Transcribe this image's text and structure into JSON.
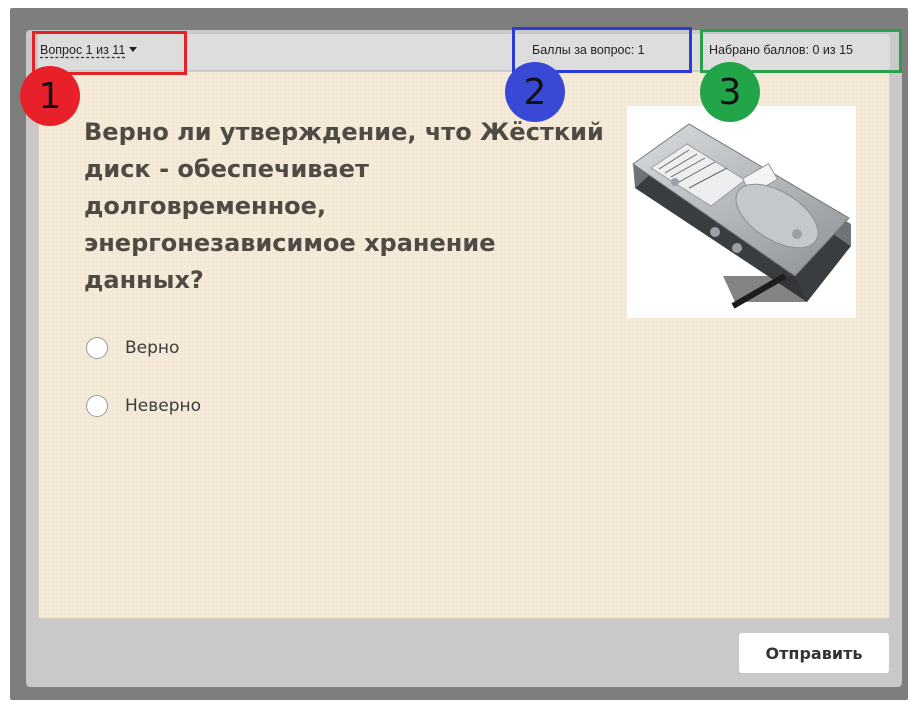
{
  "header": {
    "question_nav_label": "Вопрос 1 из 11",
    "points_per_question": "Баллы за вопрос: 1",
    "points_total": "Набрано баллов: 0 из 15"
  },
  "question": {
    "text": "Верно ли утверждение, что Жёсткий диск - обеспечивает долговременное, энергонезависимое хранение данных?",
    "image_icon": "hard-drive-image"
  },
  "options": [
    {
      "label": "Верно",
      "selected": false
    },
    {
      "label": "Неверно",
      "selected": false
    }
  ],
  "footer": {
    "submit_label": "Отправить"
  },
  "annotations": [
    {
      "number": "1",
      "color": "#e62225"
    },
    {
      "number": "2",
      "color": "#2b3bd4"
    },
    {
      "number": "3",
      "color": "#2aa04a"
    }
  ]
}
